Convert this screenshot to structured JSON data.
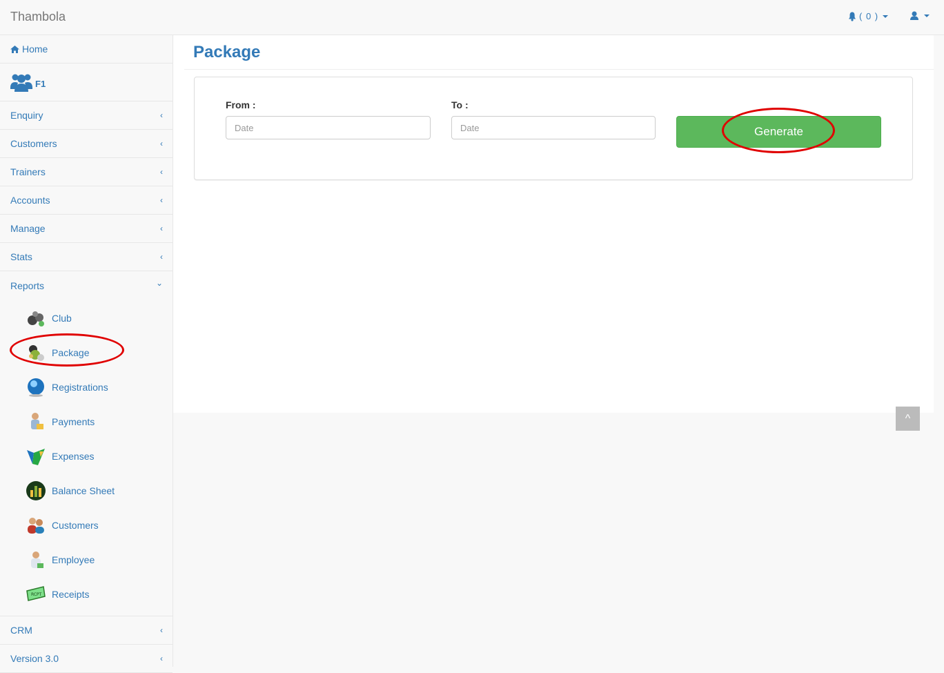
{
  "brand": "Thambola",
  "navbar": {
    "notifications_count": "( 0 )"
  },
  "sidebar": {
    "home": "Home",
    "profile": "F1",
    "items": [
      {
        "label": "Enquiry"
      },
      {
        "label": "Customers"
      },
      {
        "label": "Trainers"
      },
      {
        "label": "Accounts"
      },
      {
        "label": "Manage"
      },
      {
        "label": "Stats"
      },
      {
        "label": "Reports"
      }
    ],
    "reports": [
      {
        "label": "Club",
        "icon": "club-icon"
      },
      {
        "label": "Package",
        "icon": "package-icon"
      },
      {
        "label": "Registrations",
        "icon": "registrations-icon"
      },
      {
        "label": "Payments",
        "icon": "payments-icon"
      },
      {
        "label": "Expenses",
        "icon": "expenses-icon"
      },
      {
        "label": "Balance Sheet",
        "icon": "balance-sheet-icon"
      },
      {
        "label": "Customers",
        "icon": "customers-icon"
      },
      {
        "label": "Employee",
        "icon": "employee-icon"
      },
      {
        "label": "Receipts",
        "icon": "receipts-icon"
      }
    ],
    "bottom": [
      {
        "label": "CRM"
      },
      {
        "label": "Version 3.0"
      }
    ]
  },
  "main": {
    "title": "Package",
    "from_label": "From :",
    "to_label": "To :",
    "date_placeholder": "Date",
    "generate_label": "Generate"
  },
  "back_to_top": "^",
  "colors": {
    "link": "#337ab7",
    "success": "#5cb85c",
    "highlight": "#e00000"
  }
}
